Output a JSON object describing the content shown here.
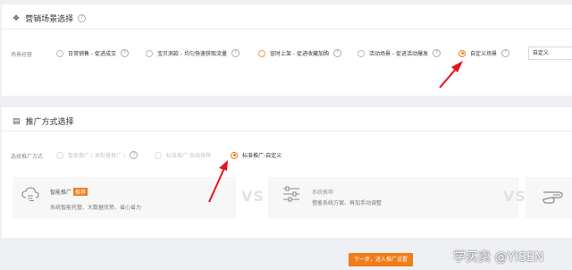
{
  "section1": {
    "title": "营销场景选择",
    "row_label": "场景经营",
    "options": [
      {
        "label": "日常销售 - 促进成交",
        "selected": false
      },
      {
        "label": "宝贝测款 - 均匀快速获取流量",
        "selected": false
      },
      {
        "label": "宣时上架 - 促进收藏加购",
        "selected": false
      },
      {
        "label": "活动场景 - 促进活动爆发",
        "selected": false
      },
      {
        "label": "自定义场景",
        "selected": true
      }
    ],
    "select_value": "自定义"
  },
  "section2": {
    "title": "推广方式选择",
    "row_label": "选择推广方式",
    "options": [
      {
        "label": "智能推广 ( 原批量推广 )",
        "disabled": true,
        "selected": false
      },
      {
        "label": "标准推广-系统推荐",
        "disabled": true,
        "selected": false
      },
      {
        "label": "标准推广-自定义",
        "disabled": false,
        "selected": true
      }
    ],
    "cards": [
      {
        "title": "智能推广",
        "tag": "推荐",
        "desc": "系统智能托管、大数据优势、省心省力"
      },
      {
        "title": "系统推荐",
        "desc": "借鉴系统方案、再加手动调整"
      }
    ],
    "vs_label": "VS"
  },
  "next_button": "下一步，进入推广设置",
  "watermark": "学买卖 @YISEN",
  "colors": {
    "accent": "#f07c1a",
    "annotation_arrow": "#e8141b"
  }
}
